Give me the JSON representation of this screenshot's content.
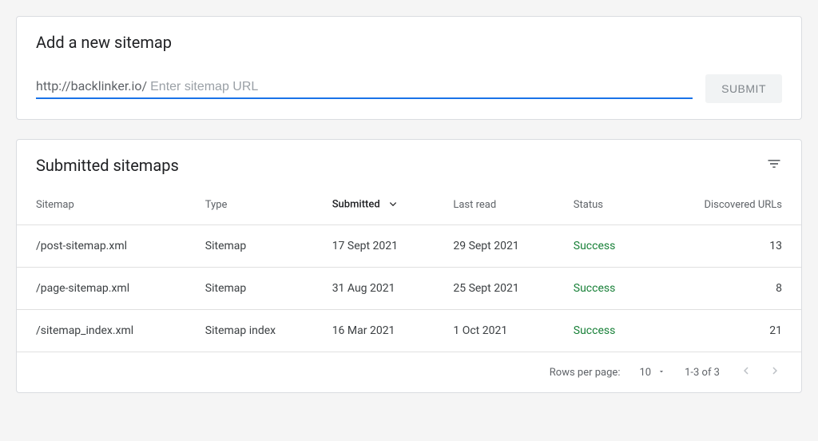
{
  "addSection": {
    "title": "Add a new sitemap",
    "urlPrefix": "http://backlinker.io/",
    "placeholder": "Enter sitemap URL",
    "submitLabel": "SUBMIT"
  },
  "tableSection": {
    "title": "Submitted sitemaps",
    "columns": {
      "sitemap": "Sitemap",
      "type": "Type",
      "submitted": "Submitted",
      "lastRead": "Last read",
      "status": "Status",
      "discovered": "Discovered URLs"
    },
    "rows": [
      {
        "sitemap": "/post-sitemap.xml",
        "type": "Sitemap",
        "submitted": "17 Sept 2021",
        "lastRead": "29 Sept 2021",
        "status": "Success",
        "discovered": "13"
      },
      {
        "sitemap": "/page-sitemap.xml",
        "type": "Sitemap",
        "submitted": "31 Aug 2021",
        "lastRead": "25 Sept 2021",
        "status": "Success",
        "discovered": "8"
      },
      {
        "sitemap": "/sitemap_index.xml",
        "type": "Sitemap index",
        "submitted": "16 Mar 2021",
        "lastRead": "1 Oct 2021",
        "status": "Success",
        "discovered": "21"
      }
    ],
    "pagination": {
      "rowsPerPageLabel": "Rows per page:",
      "rowsPerPageValue": "10",
      "rangeLabel": "1-3 of 3"
    }
  }
}
